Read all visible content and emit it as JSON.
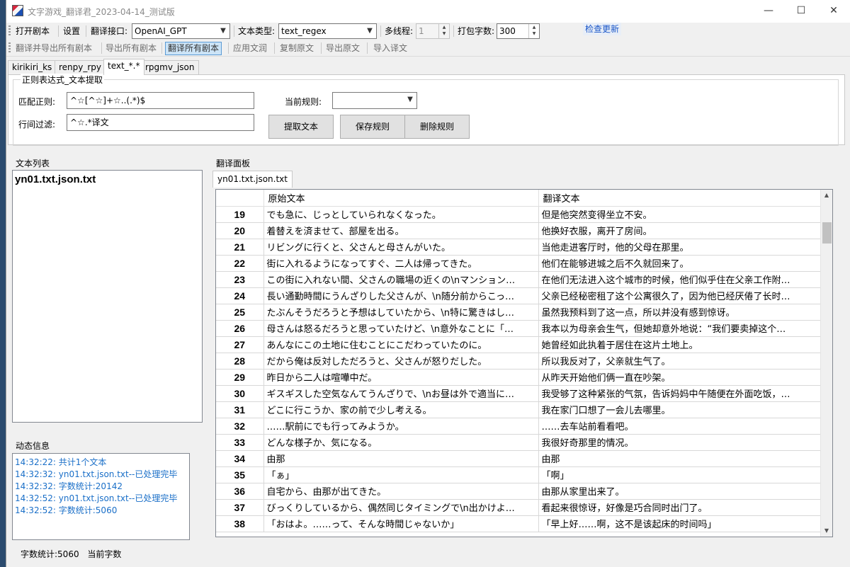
{
  "window": {
    "title": "文字游戏_翻译君_2023-04-14_测试版",
    "min_glyph": "—",
    "max_glyph": "☐",
    "close_glyph": "✕"
  },
  "toolbar": {
    "open_script": "打开剧本",
    "settings": "设置",
    "api_label": "翻译接口:",
    "api_value": "OpenAI_GPT",
    "text_type_label": "文本类型:",
    "text_type_value": "text_regex",
    "threads_label": "多线程:",
    "threads_value": "1",
    "pack_label": "打包字数:",
    "pack_value": "300",
    "check_update": "检查更新"
  },
  "toolbar2": {
    "translate_export_all": "翻译并导出所有剧本",
    "export_all": "导出所有剧本",
    "translate_all": "翻译所有剧本",
    "apply_text": "应用文润",
    "copy_original": "复制原文",
    "export_original": "导出原文",
    "import_translation": "导入译文"
  },
  "tabs": [
    "kirikiri_ks",
    "renpy_rpy",
    "text_*.*",
    "rpgmv_json"
  ],
  "regex": {
    "group_title": "正则表达式_文本提取",
    "match_label": "匹配正则:",
    "match_value": "^☆[^☆]+☆..(.*)$",
    "filter_label": "行间过滤:",
    "filter_value": "^☆.*译文",
    "current_rule_label": "当前规则:",
    "current_rule_value": "",
    "extract_btn": "提取文本",
    "save_btn": "保存规则",
    "delete_btn": "删除规则"
  },
  "text_list": {
    "label": "文本列表",
    "items": [
      "yn01.txt.json.txt"
    ]
  },
  "log": {
    "label": "动态信息",
    "lines": [
      "14:32:22: 共计1个文本",
      "14:32:32: yn01.txt.json.txt--已处理完毕",
      "14:32:32: 字数统计:20142",
      "14:32:52: yn01.txt.json.txt--已处理完毕",
      "14:32:52: 字数统计:5060"
    ]
  },
  "translate_panel": {
    "label": "翻译面板",
    "file_tab": "yn01.txt.json.txt",
    "col_original": "原始文本",
    "col_translation": "翻译文本",
    "rows": [
      {
        "n": "19",
        "orig": "でも急に、じっとしていられなくなった。",
        "trans": "但是他突然变得坐立不安。"
      },
      {
        "n": "20",
        "orig": "着替えを済ませて、部屋を出る。",
        "trans": "他换好衣服，离开了房间。"
      },
      {
        "n": "21",
        "orig": "リビングに行くと、父さんと母さんがいた。",
        "trans": "当他走进客厅时，他的父母在那里。"
      },
      {
        "n": "22",
        "orig": "街に入れるようになってすぐ、二人は帰ってきた。",
        "trans": "他们在能够进城之后不久就回来了。"
      },
      {
        "n": "23",
        "orig": "この街に入れない間、父さんの職場の近くの\\nマンション…",
        "trans": "在他们无法进入这个城市的时候，他们似乎住在父亲工作附…"
      },
      {
        "n": "24",
        "orig": "長い通勤時間にうんざりした父さんが、\\n随分前からこっ…",
        "trans": "父亲已经秘密租了这个公寓很久了，因为他已经厌倦了长时…"
      },
      {
        "n": "25",
        "orig": "たぶんそうだろうと予想はしていたから、\\n特に驚きはし…",
        "trans": "虽然我预料到了这一点，所以并没有感到惊讶。"
      },
      {
        "n": "26",
        "orig": "母さんは怒るだろうと思っていたけど、\\n意外なことに「…",
        "trans": "我本以为母亲会生气，但她却意外地说：“我们要卖掉这个…"
      },
      {
        "n": "27",
        "orig": "あんなにこの土地に住むことにこだわっていたのに。",
        "trans": "她曾经如此执着于居住在这片土地上。"
      },
      {
        "n": "28",
        "orig": "だから俺は反対しただろうと、父さんが怒りだした。",
        "trans": "所以我反对了，父亲就生气了。"
      },
      {
        "n": "29",
        "orig": "昨日から二人は喧嘩中だ。",
        "trans": "从昨天开始他们俩一直在吵架。"
      },
      {
        "n": "30",
        "orig": "ギスギスした空気なんてうんざりで、\\nお昼は外で適当に…",
        "trans": "我受够了这种紧张的气氛，告诉妈妈中午随便在外面吃饭，…"
      },
      {
        "n": "31",
        "orig": "どこに行こうか、家の前で少し考える。",
        "trans": "我在家门口想了一会儿去哪里。"
      },
      {
        "n": "32",
        "orig": "……駅前にでも行ってみようか。",
        "trans": "……去车站前看看吧。"
      },
      {
        "n": "33",
        "orig": "どんな様子か、気になる。",
        "trans": "我很好奇那里的情况。"
      },
      {
        "n": "34",
        "orig": "由那",
        "trans": "由那"
      },
      {
        "n": "35",
        "orig": "「ぁ」",
        "trans": "「啊」"
      },
      {
        "n": "36",
        "orig": "自宅から、由那が出てきた。",
        "trans": "由那从家里出来了。"
      },
      {
        "n": "37",
        "orig": "びっくりしているから、偶然同じタイミングで\\n出かけよ…",
        "trans": "看起来很惊讶，好像是巧合同时出门了。"
      },
      {
        "n": "38",
        "orig": "「おはよ。……って、そんな時間じゃないか」",
        "trans": "「早上好……啊，这不是该起床的时间吗」"
      }
    ]
  },
  "status": {
    "word_count": "字数统计:5060",
    "current_words": "当前字数"
  }
}
